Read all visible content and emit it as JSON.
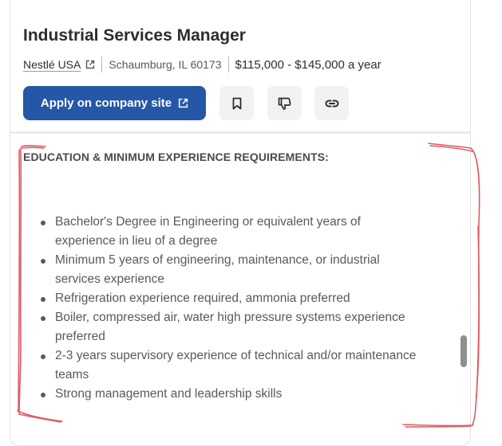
{
  "job": {
    "title": "Industrial Services Manager",
    "company": "Nestlé USA",
    "location": "Schaumburg, IL 60173",
    "salary": "$115,000 - $145,000 a year"
  },
  "actions": {
    "apply_label": "Apply on company site"
  },
  "description": {
    "section_heading": "EDUCATION & MINIMUM EXPERIENCE REQUIREMENTS:",
    "requirements": [
      [
        "Bachelor's Degree in Engineering or equivalent years of",
        "experience in lieu of a degree"
      ],
      [
        "Minimum 5 years of engineering, maintenance, or industrial",
        "services experience"
      ],
      [
        "Refrigeration experience required, ammonia preferred"
      ],
      [
        "Boiler, compressed air, water high pressure systems experience",
        "preferred"
      ],
      [
        "2-3 years supervisory experience of technical and/or maintenance",
        "teams"
      ],
      [
        "Strong management and leadership skills"
      ]
    ]
  },
  "icons": {
    "external": "external-link-icon",
    "bookmark": "bookmark-icon",
    "not_interested": "thumbs-down-icon",
    "copy_link": "link-icon"
  },
  "colors": {
    "apply_button": "#2557a7",
    "icon_button_bg": "#f3f2f1",
    "annotation": "#d9404a"
  }
}
